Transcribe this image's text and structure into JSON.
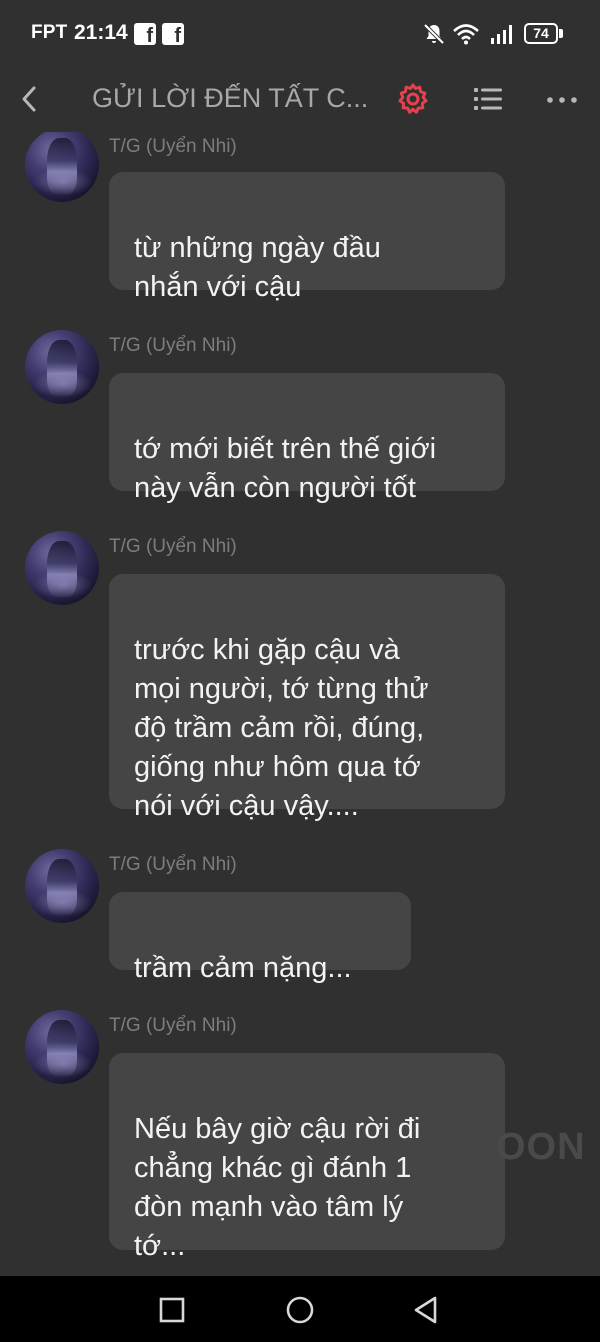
{
  "status_bar": {
    "carrier": "FPT",
    "time": "21:14",
    "notification_icons": [
      "facebook-icon",
      "facebook-icon"
    ],
    "right_icons": [
      "bell-off-icon",
      "wifi-icon",
      "signal-icon"
    ],
    "battery": "74"
  },
  "header": {
    "title": "GỬI LỜI ĐẾN TẤT C...",
    "gear_color": "#e8414e",
    "icons": [
      "back-chevron-icon",
      "gear-icon",
      "list-icon",
      "more-dots-icon"
    ]
  },
  "messages": [
    {
      "sender": "T/G (Uyển Nhi)",
      "text": "từ những ngày đầu\nnhắn với cậu"
    },
    {
      "sender": "T/G (Uyển Nhi)",
      "text": "tớ mới biết trên thế giới\nnày vẫn còn người tốt"
    },
    {
      "sender": "T/G (Uyển Nhi)",
      "text": "trước khi gặp cậu và\nmọi người, tớ từng thử\nđộ trầm cảm rồi, đúng,\ngiống như hôm qua tớ\nnói với cậu vậy...."
    },
    {
      "sender": "T/G (Uyển Nhi)",
      "text": "trầm cảm nặng..."
    },
    {
      "sender": "T/G (Uyển Nhi)",
      "text": "Nếu bây giờ cậu rời đi\nchẳng khác gì đánh 1\nđòn mạnh vào tâm lý\ntớ..."
    }
  ],
  "watermark": "OON",
  "nav_bar": {
    "icons": [
      "recent-apps-icon",
      "home-icon",
      "back-icon"
    ]
  }
}
